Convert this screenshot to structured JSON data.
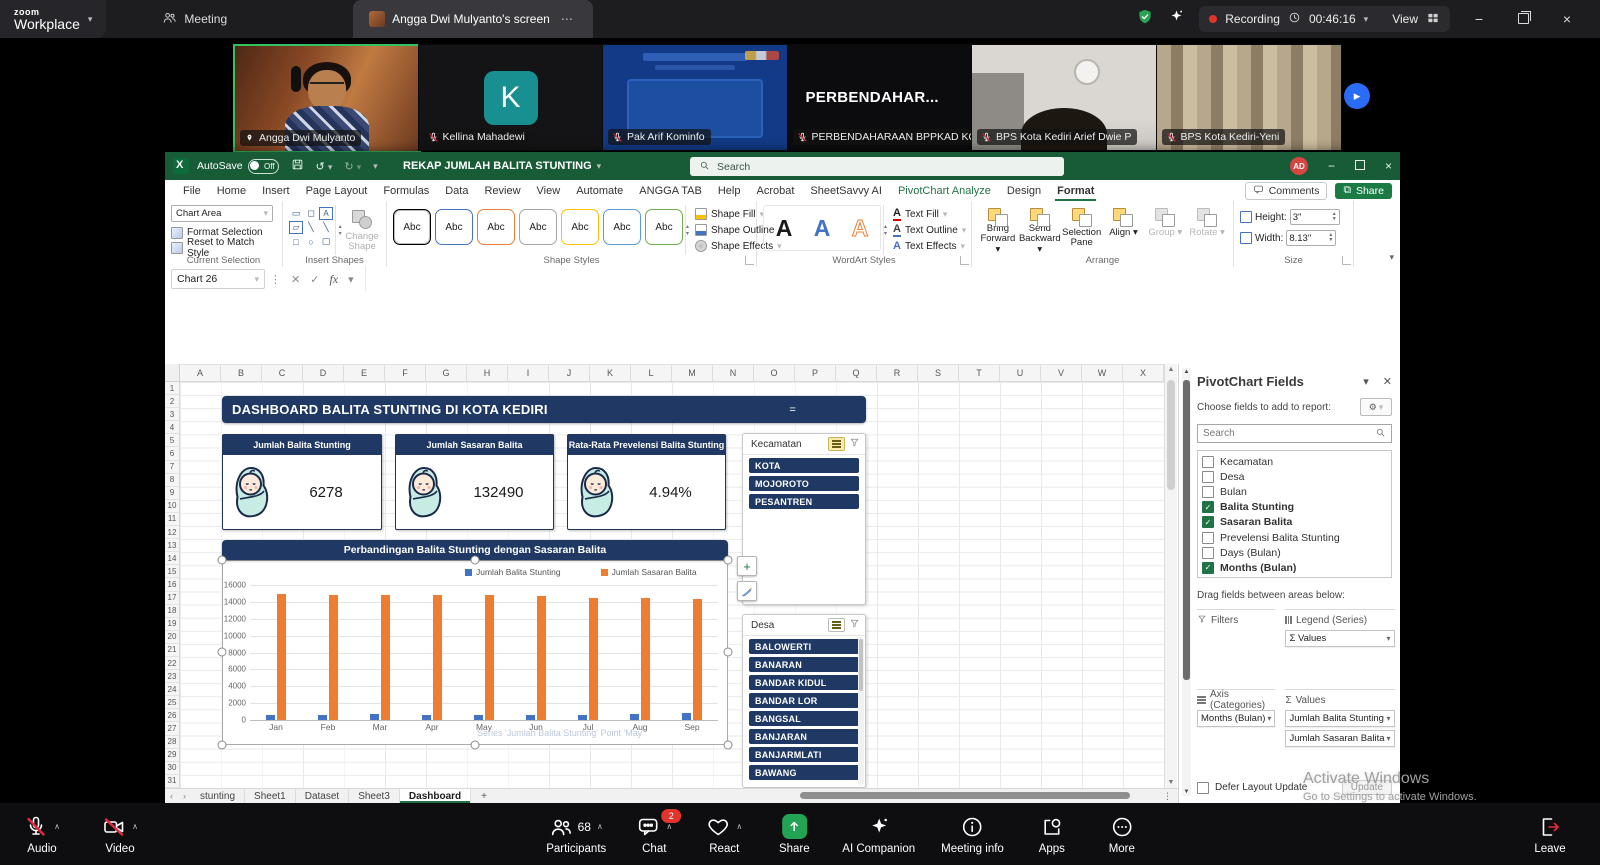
{
  "zoom_top_bar": {
    "brand_line1": "zoom",
    "brand_line2": "Workplace",
    "meeting_tab_label": "Meeting",
    "screen_tab_label": "Angga Dwi Mulyanto's screen",
    "recording_label": "Recording",
    "timer": "00:46:16",
    "view_label": "View"
  },
  "video_strip": {
    "participants": [
      {
        "name": "Angga Dwi Mulyanto",
        "kind": "photo",
        "active": true,
        "muted": false,
        "pinned": true
      },
      {
        "name": "Kellina Mahadewi",
        "kind": "letter",
        "letter": "K",
        "avatar_color": "#188f90",
        "muted": true
      },
      {
        "name": "Pak Arif Kominfo",
        "kind": "slide",
        "muted": true
      },
      {
        "name": "PERBENDAHARAAN BPPKAD KO...",
        "kind": "text",
        "display_text": "PERBENDAHAR...",
        "muted": true
      },
      {
        "name": "BPS Kota Kediri Arief Dwie P",
        "kind": "room",
        "muted": true
      },
      {
        "name": "BPS Kota Kediri-Yeni",
        "kind": "curtain",
        "muted": true
      }
    ]
  },
  "excel": {
    "title_bar": {
      "autosave_label": "AutoSave",
      "autosave_state": "Off",
      "doc_title": "REKAP JUMLAH BALITA STUNTING",
      "search_placeholder": "Search",
      "avatar_initials": "AD"
    },
    "menu_tabs": [
      "File",
      "Home",
      "Insert",
      "Page Layout",
      "Formulas",
      "Data",
      "Review",
      "View",
      "Automate",
      "ANGGA TAB",
      "Help",
      "Acrobat",
      "SheetSavvy AI",
      "PivotChart Analyze",
      "Design",
      "Format"
    ],
    "active_tab": "Format",
    "green_tabs": [
      "PivotChart Analyze"
    ],
    "comments_label": "Comments",
    "share_label": "Share",
    "ribbon": {
      "current_selection": {
        "selector_value": "Chart Area",
        "format_selection_label": "Format Selection",
        "reset_label": "Reset to Match Style",
        "group_label": "Current Selection"
      },
      "insert_shapes": {
        "change_shape_label": "Change Shape",
        "group_label": "Insert Shapes"
      },
      "shape_styles": {
        "sample_label": "Abc",
        "sample_colors": [
          "#000000",
          "#4472c4",
          "#ed7d31",
          "#a5a5a5",
          "#ffc000",
          "#5b9bd5",
          "#70ad47"
        ],
        "fill_label": "Shape Fill",
        "outline_label": "Shape Outline",
        "effects_label": "Shape Effects",
        "group_label": "Shape Styles"
      },
      "wordart_styles": {
        "letters": [
          "A",
          "A",
          "A"
        ],
        "letter_colors": [
          "#1a1a1a",
          "#4472c4",
          "#ed7d31"
        ],
        "text_fill_label": "Text Fill",
        "text_outline_label": "Text Outline",
        "text_effects_label": "Text Effects",
        "group_label": "WordArt Styles"
      },
      "arrange": {
        "items": [
          {
            "label": "Bring Forward",
            "enabled": true
          },
          {
            "label": "Send Backward",
            "enabled": true
          },
          {
            "label": "Selection Pane",
            "enabled": true
          },
          {
            "label": "Align",
            "enabled": true
          },
          {
            "label": "Group",
            "enabled": false
          },
          {
            "label": "Rotate",
            "enabled": false
          }
        ],
        "group_label": "Arrange"
      },
      "size": {
        "height_label": "Height:",
        "height_value": "3\"",
        "width_label": "Width:",
        "width_value": "8.13\"",
        "group_label": "Size"
      }
    },
    "name_box": "Chart 26",
    "columns": [
      "A",
      "B",
      "C",
      "D",
      "E",
      "F",
      "G",
      "H",
      "I",
      "J",
      "K",
      "L",
      "M",
      "N",
      "O",
      "P",
      "Q",
      "R",
      "S",
      "T",
      "U",
      "V",
      "W",
      "X"
    ],
    "row_count": 31,
    "sheet_tabs": [
      "stunting",
      "Sheet1",
      "Dataset",
      "Sheet3",
      "Dashboard"
    ],
    "active_sheet": "Dashboard"
  },
  "dashboard": {
    "title": "DASHBOARD BALITA STUNTING DI KOTA KEDIRI",
    "title_suffix": "=",
    "accent_color": "#1f3864",
    "cards": [
      {
        "title": "Jumlah Balita Stunting",
        "value": "6278"
      },
      {
        "title": "Jumlah Sasaran Balita",
        "value": "132490"
      },
      {
        "title": "Rata-Rata Prevelensi Balita Stunting",
        "value": "4.94%"
      }
    ],
    "slicers": [
      {
        "title": "Kecamatan",
        "items": [
          "KOTA",
          "MOJOROTO",
          "PESANTREN"
        ]
      },
      {
        "title": "Desa",
        "items": [
          "BALOWERTI",
          "BANARAN",
          "BANDAR KIDUL",
          "BANDAR LOR",
          "BANGSAL",
          "BANJARAN",
          "BANJARMLATI",
          "BAWANG"
        ]
      }
    ]
  },
  "chart_data": {
    "type": "bar",
    "title": "Perbandingan Balita Stunting dengan Sasaran Balita",
    "categories": [
      "Jan",
      "Feb",
      "Mar",
      "Apr",
      "May",
      "Jun",
      "Jul",
      "Aug",
      "Sep"
    ],
    "series": [
      {
        "name": "Jumlah Balita Stunting",
        "color": "#4472c4",
        "values": [
          650,
          650,
          660,
          650,
          650,
          640,
          650,
          660,
          780
        ]
      },
      {
        "name": "Jumlah Sasaran Balita",
        "color": "#ed7d31",
        "values": [
          14900,
          14850,
          14860,
          14860,
          14800,
          14700,
          14470,
          14500,
          14380
        ]
      }
    ],
    "ylim": [
      0,
      16000
    ],
    "ytick_step": 2000,
    "grid": true,
    "legend_position": "top",
    "ghost_tooltip": "Series 'Jumlah Balita Stunting' Point 'May'"
  },
  "pivot_panel": {
    "title": "PivotChart Fields",
    "subtitle": "Choose fields to add to report:",
    "search_placeholder": "Search",
    "fields": [
      {
        "label": "Kecamatan",
        "checked": false
      },
      {
        "label": "Desa",
        "checked": false
      },
      {
        "label": "Bulan",
        "checked": false
      },
      {
        "label": "Balita Stunting",
        "checked": true
      },
      {
        "label": "Sasaran Balita",
        "checked": true
      },
      {
        "label": "Prevelensi Balita Stunting",
        "checked": false
      },
      {
        "label": "Days (Bulan)",
        "checked": false
      },
      {
        "label": "Months (Bulan)",
        "checked": true
      }
    ],
    "drag_label": "Drag fields between areas below:",
    "areas": {
      "filters_label": "Filters",
      "legend_label": "Legend (Series)",
      "axis_label": "Axis (Categories)",
      "values_label": "Values",
      "filters_items": [],
      "legend_items": [
        "Σ Values"
      ],
      "axis_items": [
        "Months (Bulan)"
      ],
      "values_items": [
        "Jumlah Balita Stunting",
        "Jumlah Sasaran Balita"
      ]
    },
    "defer_label": "Defer Layout Update",
    "update_label": "Update"
  },
  "watermark": {
    "line1": "Activate Windows",
    "line2": "Go to Settings to activate Windows."
  },
  "zoom_toolbar": {
    "left_items": [
      {
        "label": "Audio",
        "icon": "mic-off",
        "chevron": true
      },
      {
        "label": "Video",
        "icon": "cam-off",
        "chevron": true
      }
    ],
    "center_items": [
      {
        "label": "Participants",
        "icon": "people",
        "count": "68",
        "chevron": true
      },
      {
        "label": "Chat",
        "icon": "chat",
        "badge": "2",
        "chevron": true
      },
      {
        "label": "React",
        "icon": "heart",
        "chevron": true
      },
      {
        "label": "Share",
        "icon": "share"
      },
      {
        "label": "AI Companion",
        "icon": "sparkle"
      },
      {
        "label": "Meeting info",
        "icon": "info"
      },
      {
        "label": "Apps",
        "icon": "apps"
      },
      {
        "label": "More",
        "icon": "more"
      }
    ],
    "leave_label": "Leave"
  }
}
